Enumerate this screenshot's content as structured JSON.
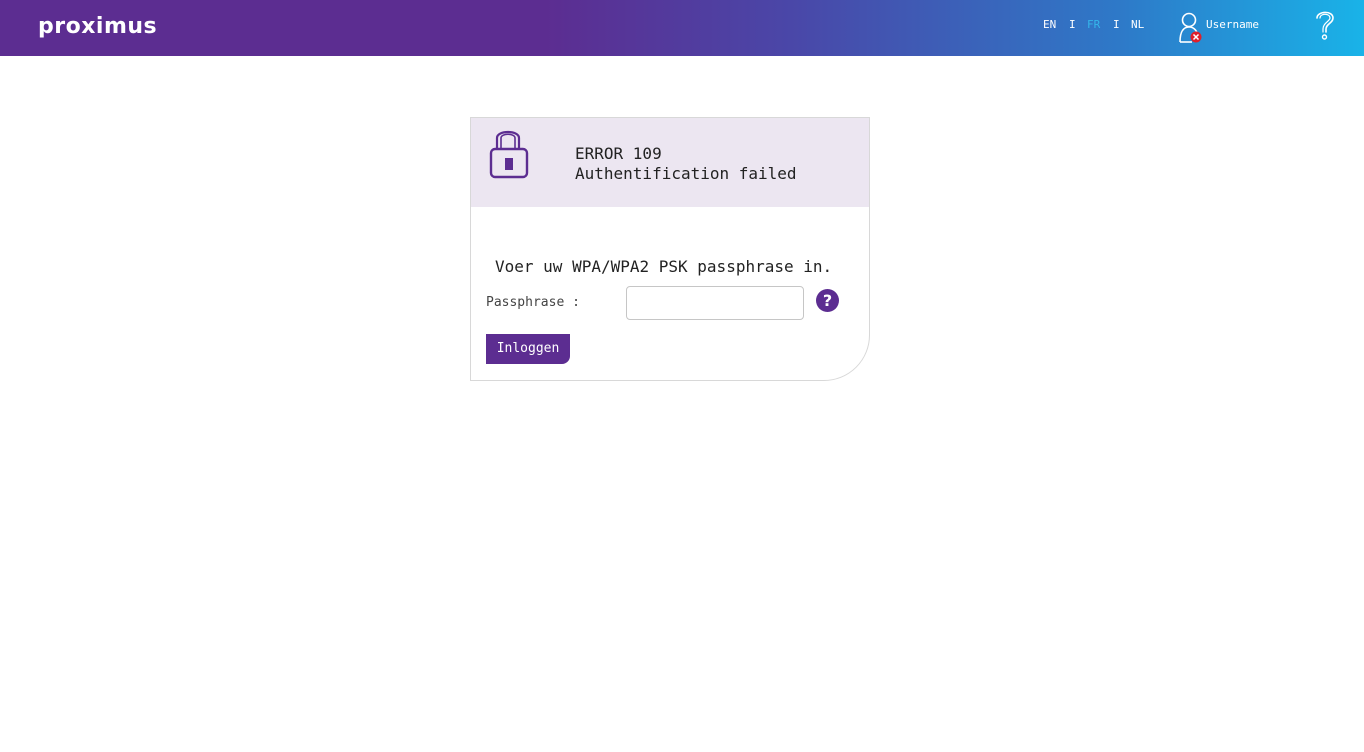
{
  "header": {
    "logo_text": "proximus",
    "languages": [
      {
        "label": "EN",
        "active": false
      },
      {
        "label": "FR",
        "active": true
      },
      {
        "label": "NL",
        "active": false
      }
    ],
    "separator": "I",
    "username": "Username",
    "user_icon": "user-error-icon",
    "help_icon": "question-mark-icon"
  },
  "login": {
    "lock_icon": "padlock-icon",
    "error_code": "ERROR 109",
    "error_message": "Authentification failed",
    "prompt": "Voer uw WPA/WPA2 PSK passphrase in.",
    "passphrase_label": "Passphrase :",
    "passphrase_value": "",
    "help_symbol": "?",
    "login_button": "Inloggen"
  },
  "colors": {
    "brand_purple": "#5c2d91",
    "brand_blue": "#19b3e8",
    "active_language": "#35b6ea",
    "error_red": "#e0202a",
    "panel_bg": "#ece6f1"
  }
}
